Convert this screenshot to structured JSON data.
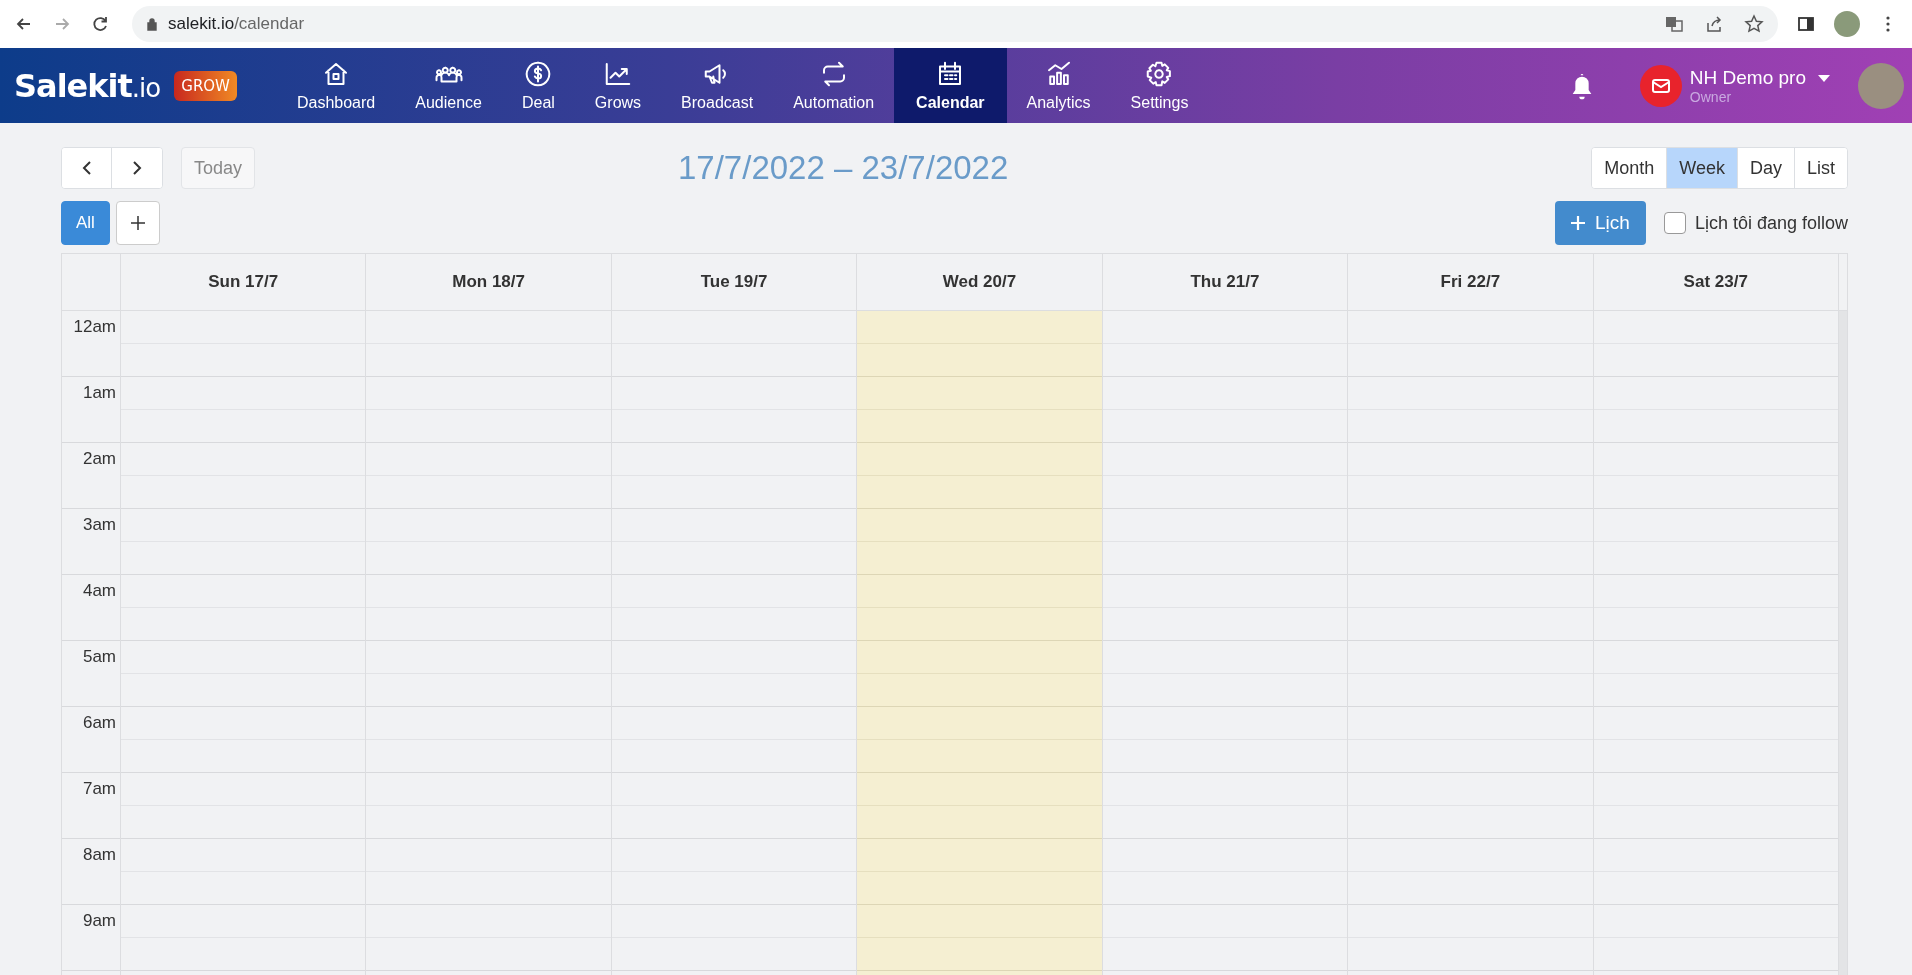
{
  "browser": {
    "url_host": "salekit.io",
    "url_path": "/calendar"
  },
  "brand": {
    "logo_main": "Salekit",
    "logo_suffix": ".io",
    "badge": "GROW"
  },
  "nav": [
    {
      "label": "Dashboard",
      "selected": false
    },
    {
      "label": "Audience",
      "selected": false
    },
    {
      "label": "Deal",
      "selected": false
    },
    {
      "label": "Grows",
      "selected": false
    },
    {
      "label": "Broadcast",
      "selected": false
    },
    {
      "label": "Automation",
      "selected": false
    },
    {
      "label": "Calendar",
      "selected": true
    },
    {
      "label": "Analytics",
      "selected": false
    },
    {
      "label": "Settings",
      "selected": false
    }
  ],
  "user": {
    "name": "NH Demo pro",
    "role": "Owner"
  },
  "toolbar": {
    "today": "Today",
    "range": "17/7/2022 – 23/7/2022",
    "views": [
      {
        "label": "Month",
        "selected": false
      },
      {
        "label": "Week",
        "selected": true
      },
      {
        "label": "Day",
        "selected": false
      },
      {
        "label": "List",
        "selected": false
      }
    ],
    "filters": [
      {
        "label": "All",
        "selected": true
      }
    ],
    "add_calendar": "Lịch",
    "follow": {
      "label": "Lịch tôi đang follow",
      "checked": false
    }
  },
  "days": [
    {
      "label": "Sun 17/7",
      "today": false
    },
    {
      "label": "Mon 18/7",
      "today": false
    },
    {
      "label": "Tue 19/7",
      "today": false
    },
    {
      "label": "Wed 20/7",
      "today": true
    },
    {
      "label": "Thu 21/7",
      "today": false
    },
    {
      "label": "Fri 22/7",
      "today": false
    },
    {
      "label": "Sat 23/7",
      "today": false
    }
  ],
  "hours": [
    "12am",
    "1am",
    "2am",
    "3am",
    "4am",
    "5am",
    "6am",
    "7am",
    "8am",
    "9am"
  ]
}
